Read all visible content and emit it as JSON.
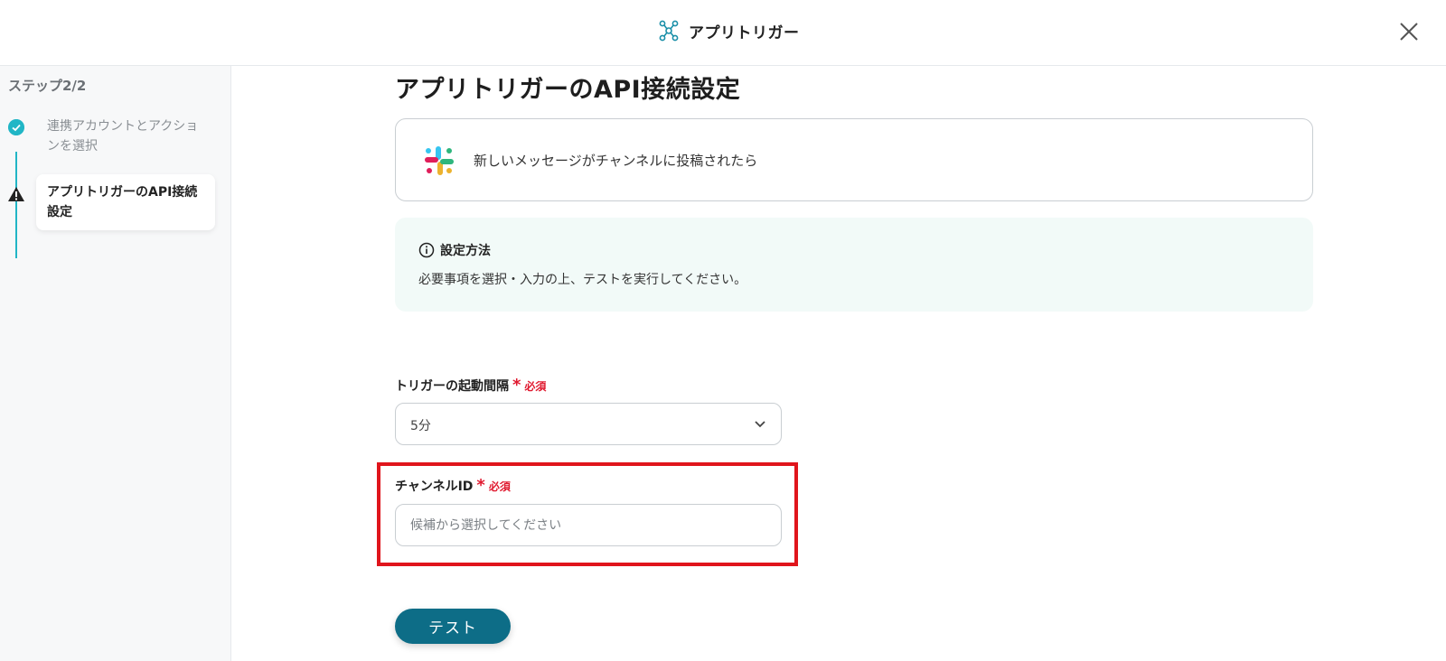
{
  "header": {
    "title": "アプリトリガー",
    "logo_icon": "app-trigger-logo-icon",
    "close_icon": "close-icon"
  },
  "sidebar": {
    "step_count": "ステップ2/2",
    "steps": [
      {
        "label": "連携アカウントとアクションを選択",
        "status": "done",
        "icon": "check-circle-icon"
      },
      {
        "label": "アプリトリガーのAPI接続設定",
        "status": "current",
        "icon": "warning-icon"
      }
    ]
  },
  "main": {
    "title": "アプリトリガーのAPI接続設定",
    "trigger": {
      "icon": "slack-icon",
      "text": "新しいメッセージがチャンネルに投稿されたら"
    },
    "help": {
      "icon": "info-icon",
      "title": "設定方法",
      "text": "必要事項を選択・入力の上、テストを実行してください。"
    },
    "interval": {
      "label": "トリガーの起動間隔",
      "required_mark": "*",
      "required_text": "必須",
      "value": "5分"
    },
    "channel": {
      "label": "チャンネルID",
      "required_mark": "*",
      "required_text": "必須",
      "placeholder": "候補から選択してください",
      "value": ""
    },
    "test_button": "テスト"
  },
  "colors": {
    "accent": "#21b6c6",
    "button": "#0d6d87",
    "required": "#e0192f",
    "highlight": "#e0151c",
    "help_bg": "#f2faf8"
  }
}
